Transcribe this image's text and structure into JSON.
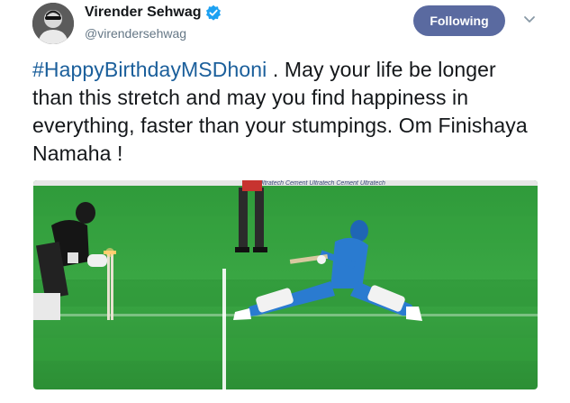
{
  "author": {
    "display_name": "Virender Sehwag",
    "handle": "@virendersehwag",
    "verified": true
  },
  "follow_button": {
    "label": "Following",
    "color": "#5a6aa0"
  },
  "menu": {
    "icon": "chevron-down-icon"
  },
  "tweet": {
    "hashtag": "#HappyBirthdayMSDhoni",
    "body": " . May your life be longer than this stretch and may you find happiness in everything, faster than your stumpings. Om Finishaya Namaha !",
    "hashtag_color": "#1b5f9b"
  },
  "media": {
    "kind": "photo",
    "banner_text": "Ultratech Cement   Ultratech Cement   Ultratech"
  }
}
